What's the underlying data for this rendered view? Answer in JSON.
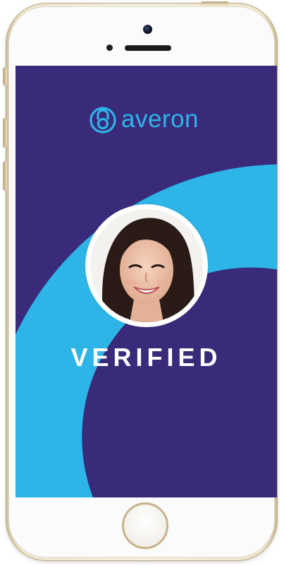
{
  "device": {
    "type": "iphone",
    "frame_color": "#efe6cf"
  },
  "app": {
    "logo_text": "averon",
    "logo_icon": "lock-ring-icon",
    "status_text": "VERIFIED",
    "colors": {
      "background": "#3a2a7a",
      "accent": "#2db5e8",
      "text": "#ffffff"
    }
  },
  "profile": {
    "photo": "user-portrait"
  }
}
